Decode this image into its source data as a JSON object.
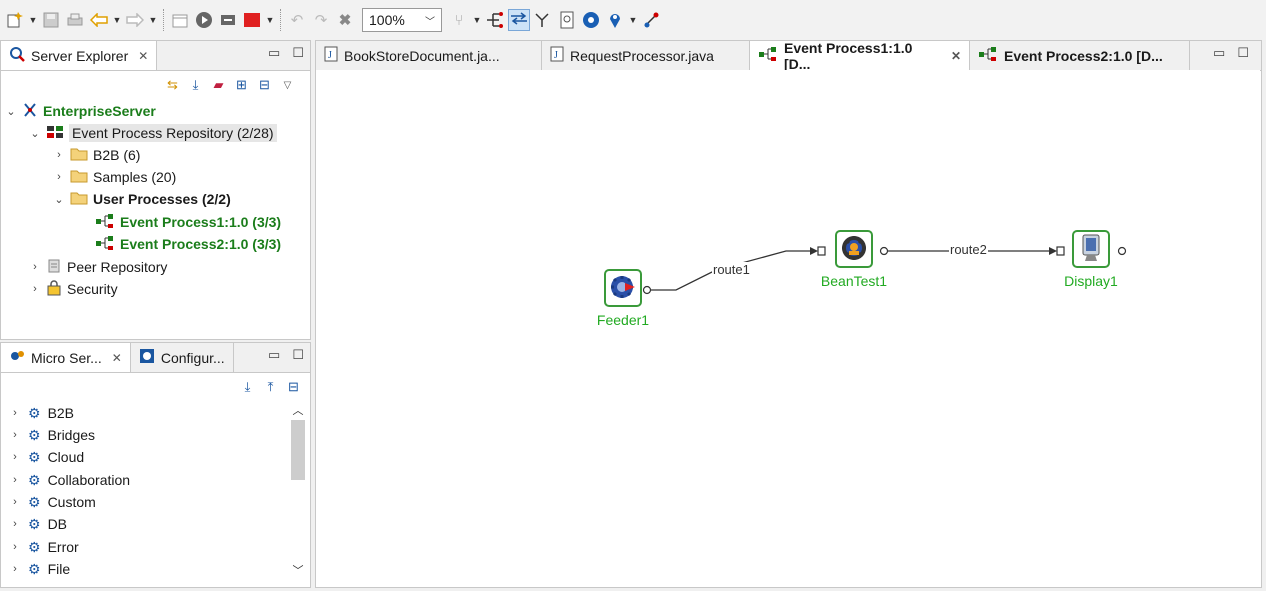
{
  "toolbar": {
    "zoom_value": "100%"
  },
  "server_explorer": {
    "tab_label": "Server Explorer",
    "tree": [
      {
        "label": "EnterpriseServer",
        "style": "green-bold"
      },
      {
        "label": "Event Process Repository (2/28)"
      },
      {
        "label": "B2B (6)"
      },
      {
        "label": "Samples (20)"
      },
      {
        "label": "User Processes (2/2)"
      },
      {
        "label": "Event Process1:1.0 (3/3)"
      },
      {
        "label": "Event Process2:1.0 (3/3)"
      },
      {
        "label": "Peer Repository"
      },
      {
        "label": "Security"
      }
    ]
  },
  "micro_services": {
    "tab_label": "Micro Ser...",
    "config_tab_label": "Configur...",
    "items": [
      "B2B",
      "Bridges",
      "Cloud",
      "Collaboration",
      "Custom",
      "DB",
      "Error",
      "File"
    ]
  },
  "editor": {
    "tabs": [
      {
        "label": "BookStoreDocument.ja..."
      },
      {
        "label": "RequestProcessor.java"
      },
      {
        "label": "Event Process1:1.0 [D...",
        "active": true
      },
      {
        "label": "Event Process2:1.0 [D..."
      }
    ]
  },
  "flow": {
    "nodes": [
      {
        "id": "feeder",
        "label": "Feeder1"
      },
      {
        "id": "beantest",
        "label": "BeanTest1"
      },
      {
        "id": "display",
        "label": "Display1"
      }
    ],
    "routes": [
      {
        "label": "route1"
      },
      {
        "label": "route2"
      }
    ]
  },
  "colors": {
    "node_label": "#22aa22",
    "node_border": "#3a9a3a",
    "tree_green": "#1b7d1b"
  }
}
